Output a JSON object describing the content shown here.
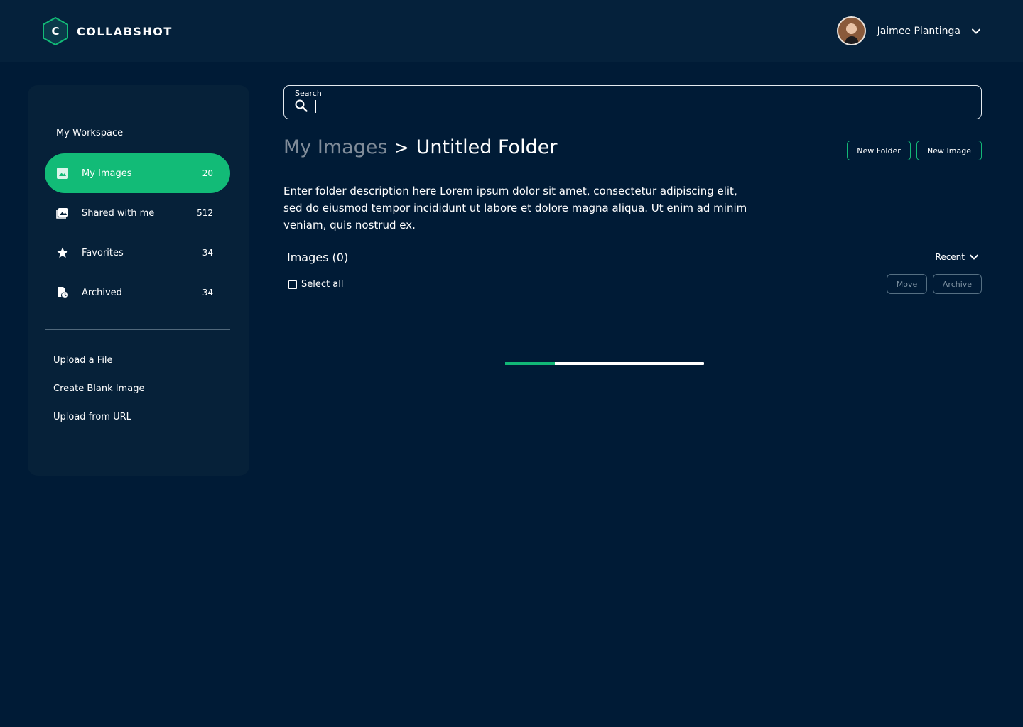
{
  "header": {
    "logo_letter": "C",
    "app_name": "COLLABSHOT",
    "user_name": "Jaimee Plantinga"
  },
  "sidebar": {
    "workspace_title": "My Workspace",
    "items": [
      {
        "label": "My Images",
        "count": "20",
        "icon": "image-icon",
        "active": true
      },
      {
        "label": "Shared with me",
        "count": "512",
        "icon": "shared-images-icon",
        "active": false
      },
      {
        "label": "Favorites",
        "count": "34",
        "icon": "star-icon",
        "active": false
      },
      {
        "label": "Archived",
        "count": "34",
        "icon": "archive-clock-icon",
        "active": false
      }
    ],
    "links": [
      "Upload a File",
      "Create Blank Image",
      "Upload from URL"
    ]
  },
  "search": {
    "label": "Search",
    "value": ""
  },
  "breadcrumb": {
    "root": "My Images",
    "separator": ">",
    "current": "Untitled Folder"
  },
  "actions": {
    "new_folder": "New Folder",
    "new_image": "New Image"
  },
  "folder": {
    "description": "Enter folder description here Lorem ipsum dolor sit amet, consectetur adipiscing elit, sed do eiusmod tempor incididunt ut labore et dolore magna aliqua. Ut enim ad minim veniam, quis nostrud ex."
  },
  "images": {
    "title": "Images (0)",
    "sort": "Recent",
    "select_all": "Select all",
    "move": "Move",
    "archive": "Archive"
  },
  "loading": {
    "progress": 0.25
  },
  "colors": {
    "background": "#001b36",
    "header": "#05213b",
    "sidebar": "#062139",
    "accent": "#12bb77"
  }
}
